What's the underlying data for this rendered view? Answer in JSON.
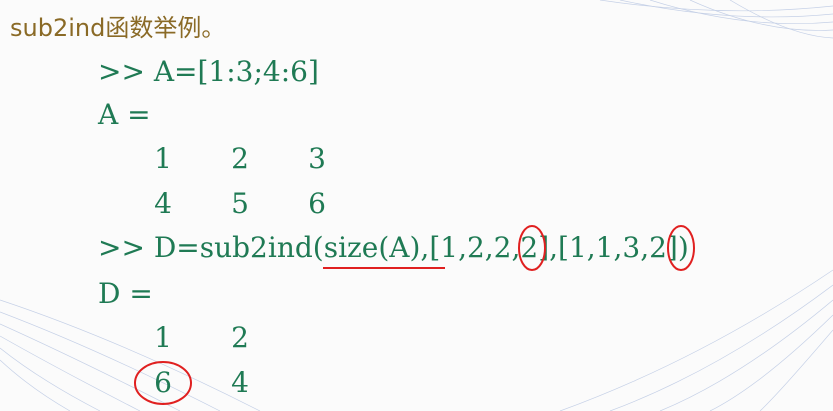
{
  "title": "sub2ind函数举例。",
  "commands": {
    "line1": ">> A=[1:3;4:6]",
    "a_label": "A =",
    "line2": ">> D=sub2ind(size(A),[1,2,2,2],[1,1,3,2])",
    "d_label": "D ="
  },
  "matrix_a": [
    [
      "1",
      "2",
      "3"
    ],
    [
      "4",
      "5",
      "6"
    ]
  ],
  "matrix_d": [
    [
      "1",
      "2"
    ],
    [
      "6",
      "4"
    ]
  ],
  "colors": {
    "code": "#1f7a54",
    "title": "#8a6a26",
    "annotation": "#e02020"
  }
}
